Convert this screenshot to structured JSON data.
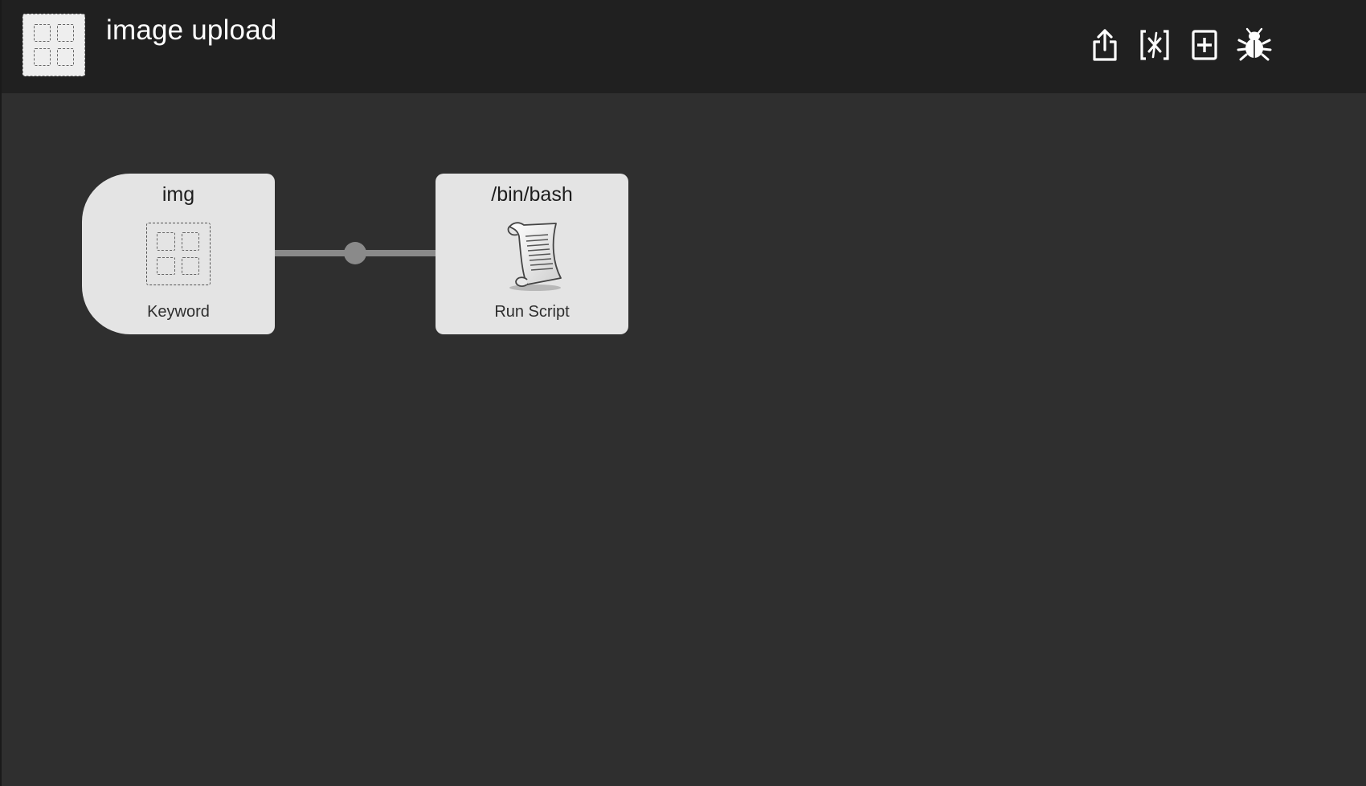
{
  "header": {
    "title": "image upload",
    "workflow_icon": "workflow-grid-icon",
    "toolbar": [
      {
        "name": "share",
        "icon": "share-icon"
      },
      {
        "name": "variables",
        "icon": "variables-icon"
      },
      {
        "name": "add",
        "icon": "add-icon"
      },
      {
        "name": "debug",
        "icon": "bug-icon"
      }
    ]
  },
  "canvas": {
    "nodes": [
      {
        "title": "img",
        "label": "Keyword",
        "icon": "keyword-grid-icon"
      },
      {
        "title": "/bin/bash",
        "label": "Run Script",
        "icon": "script-scroll-icon"
      }
    ],
    "connections": [
      {
        "from": "Keyword",
        "to": "Run Script"
      }
    ]
  },
  "colors": {
    "header_bg": "#202020",
    "canvas_bg": "#2f2f2f",
    "node_bg": "#e4e4e4",
    "connector": "#8a8a8a"
  }
}
